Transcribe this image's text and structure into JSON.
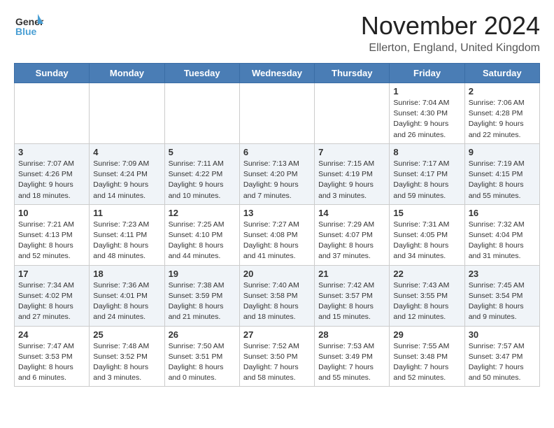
{
  "header": {
    "logo_line1": "General",
    "logo_line2": "Blue",
    "month": "November 2024",
    "location": "Ellerton, England, United Kingdom"
  },
  "weekdays": [
    "Sunday",
    "Monday",
    "Tuesday",
    "Wednesday",
    "Thursday",
    "Friday",
    "Saturday"
  ],
  "weeks": [
    [
      {
        "day": "",
        "info": ""
      },
      {
        "day": "",
        "info": ""
      },
      {
        "day": "",
        "info": ""
      },
      {
        "day": "",
        "info": ""
      },
      {
        "day": "",
        "info": ""
      },
      {
        "day": "1",
        "info": "Sunrise: 7:04 AM\nSunset: 4:30 PM\nDaylight: 9 hours and 26 minutes."
      },
      {
        "day": "2",
        "info": "Sunrise: 7:06 AM\nSunset: 4:28 PM\nDaylight: 9 hours and 22 minutes."
      }
    ],
    [
      {
        "day": "3",
        "info": "Sunrise: 7:07 AM\nSunset: 4:26 PM\nDaylight: 9 hours and 18 minutes."
      },
      {
        "day": "4",
        "info": "Sunrise: 7:09 AM\nSunset: 4:24 PM\nDaylight: 9 hours and 14 minutes."
      },
      {
        "day": "5",
        "info": "Sunrise: 7:11 AM\nSunset: 4:22 PM\nDaylight: 9 hours and 10 minutes."
      },
      {
        "day": "6",
        "info": "Sunrise: 7:13 AM\nSunset: 4:20 PM\nDaylight: 9 hours and 7 minutes."
      },
      {
        "day": "7",
        "info": "Sunrise: 7:15 AM\nSunset: 4:19 PM\nDaylight: 9 hours and 3 minutes."
      },
      {
        "day": "8",
        "info": "Sunrise: 7:17 AM\nSunset: 4:17 PM\nDaylight: 8 hours and 59 minutes."
      },
      {
        "day": "9",
        "info": "Sunrise: 7:19 AM\nSunset: 4:15 PM\nDaylight: 8 hours and 55 minutes."
      }
    ],
    [
      {
        "day": "10",
        "info": "Sunrise: 7:21 AM\nSunset: 4:13 PM\nDaylight: 8 hours and 52 minutes."
      },
      {
        "day": "11",
        "info": "Sunrise: 7:23 AM\nSunset: 4:11 PM\nDaylight: 8 hours and 48 minutes."
      },
      {
        "day": "12",
        "info": "Sunrise: 7:25 AM\nSunset: 4:10 PM\nDaylight: 8 hours and 44 minutes."
      },
      {
        "day": "13",
        "info": "Sunrise: 7:27 AM\nSunset: 4:08 PM\nDaylight: 8 hours and 41 minutes."
      },
      {
        "day": "14",
        "info": "Sunrise: 7:29 AM\nSunset: 4:07 PM\nDaylight: 8 hours and 37 minutes."
      },
      {
        "day": "15",
        "info": "Sunrise: 7:31 AM\nSunset: 4:05 PM\nDaylight: 8 hours and 34 minutes."
      },
      {
        "day": "16",
        "info": "Sunrise: 7:32 AM\nSunset: 4:04 PM\nDaylight: 8 hours and 31 minutes."
      }
    ],
    [
      {
        "day": "17",
        "info": "Sunrise: 7:34 AM\nSunset: 4:02 PM\nDaylight: 8 hours and 27 minutes."
      },
      {
        "day": "18",
        "info": "Sunrise: 7:36 AM\nSunset: 4:01 PM\nDaylight: 8 hours and 24 minutes."
      },
      {
        "day": "19",
        "info": "Sunrise: 7:38 AM\nSunset: 3:59 PM\nDaylight: 8 hours and 21 minutes."
      },
      {
        "day": "20",
        "info": "Sunrise: 7:40 AM\nSunset: 3:58 PM\nDaylight: 8 hours and 18 minutes."
      },
      {
        "day": "21",
        "info": "Sunrise: 7:42 AM\nSunset: 3:57 PM\nDaylight: 8 hours and 15 minutes."
      },
      {
        "day": "22",
        "info": "Sunrise: 7:43 AM\nSunset: 3:55 PM\nDaylight: 8 hours and 12 minutes."
      },
      {
        "day": "23",
        "info": "Sunrise: 7:45 AM\nSunset: 3:54 PM\nDaylight: 8 hours and 9 minutes."
      }
    ],
    [
      {
        "day": "24",
        "info": "Sunrise: 7:47 AM\nSunset: 3:53 PM\nDaylight: 8 hours and 6 minutes."
      },
      {
        "day": "25",
        "info": "Sunrise: 7:48 AM\nSunset: 3:52 PM\nDaylight: 8 hours and 3 minutes."
      },
      {
        "day": "26",
        "info": "Sunrise: 7:50 AM\nSunset: 3:51 PM\nDaylight: 8 hours and 0 minutes."
      },
      {
        "day": "27",
        "info": "Sunrise: 7:52 AM\nSunset: 3:50 PM\nDaylight: 7 hours and 58 minutes."
      },
      {
        "day": "28",
        "info": "Sunrise: 7:53 AM\nSunset: 3:49 PM\nDaylight: 7 hours and 55 minutes."
      },
      {
        "day": "29",
        "info": "Sunrise: 7:55 AM\nSunset: 3:48 PM\nDaylight: 7 hours and 52 minutes."
      },
      {
        "day": "30",
        "info": "Sunrise: 7:57 AM\nSunset: 3:47 PM\nDaylight: 7 hours and 50 minutes."
      }
    ]
  ]
}
